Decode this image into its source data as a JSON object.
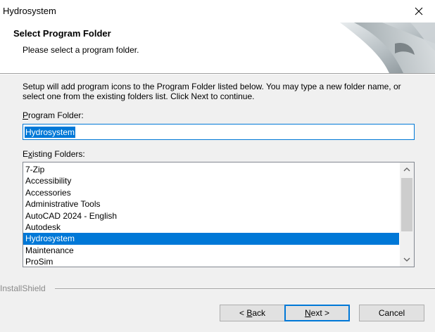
{
  "window": {
    "title": "Hydrosystem",
    "close_icon": "close-icon"
  },
  "header": {
    "title": "Select Program Folder",
    "subtitle": "Please select a program folder."
  },
  "instructions": "Setup will add program icons to the Program Folder listed below.  You may type a new folder name, or select one from the existing folders list.  Click Next to continue.",
  "program_folder": {
    "label_mnemonic": "P",
    "label_rest": "rogram Folder:",
    "value": "Hydrosystem"
  },
  "existing_folders": {
    "label_prefix": "E",
    "label_mnemonic": "x",
    "label_rest": "isting Folders:",
    "items": [
      "7-Zip",
      "Accessibility",
      "Accessories",
      "Administrative Tools",
      "AutoCAD 2024 - English",
      "Autodesk",
      "Hydrosystem",
      "Maintenance",
      "ProSim"
    ],
    "selected": "Hydrosystem"
  },
  "footer": {
    "brand": "InstallShield",
    "back_prefix": "< ",
    "back_mnemonic": "B",
    "back_rest": "ack",
    "next_mnemonic": "N",
    "next_rest": "ext >",
    "cancel_label": "Cancel"
  },
  "colors": {
    "accent": "#0078d7",
    "selection_text": "#ffffff"
  }
}
